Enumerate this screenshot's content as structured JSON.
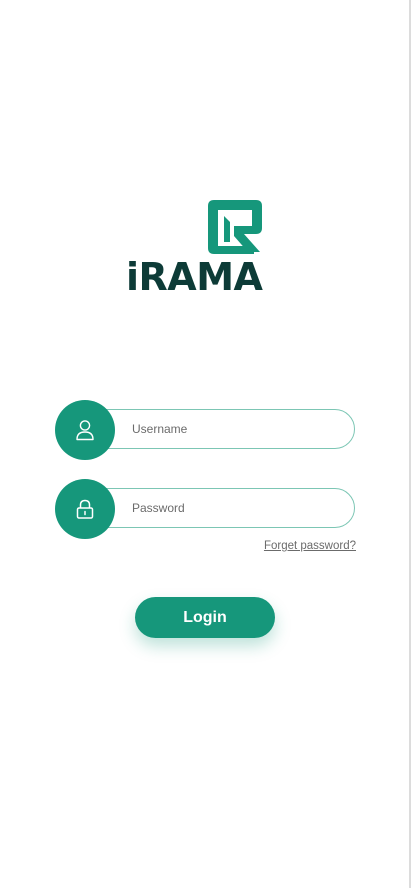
{
  "brand": {
    "name": "iRAMA",
    "primary_color": "#16977b",
    "dark_color": "#0d3b37",
    "logo_icon": "leaf-k-icon"
  },
  "login_form": {
    "username": {
      "placeholder": "Username",
      "value": "",
      "icon": "user-icon"
    },
    "password": {
      "placeholder": "Password",
      "value": "",
      "icon": "lock-icon"
    },
    "forgot_password_label": "Forget password?",
    "login_button_label": "Login"
  }
}
